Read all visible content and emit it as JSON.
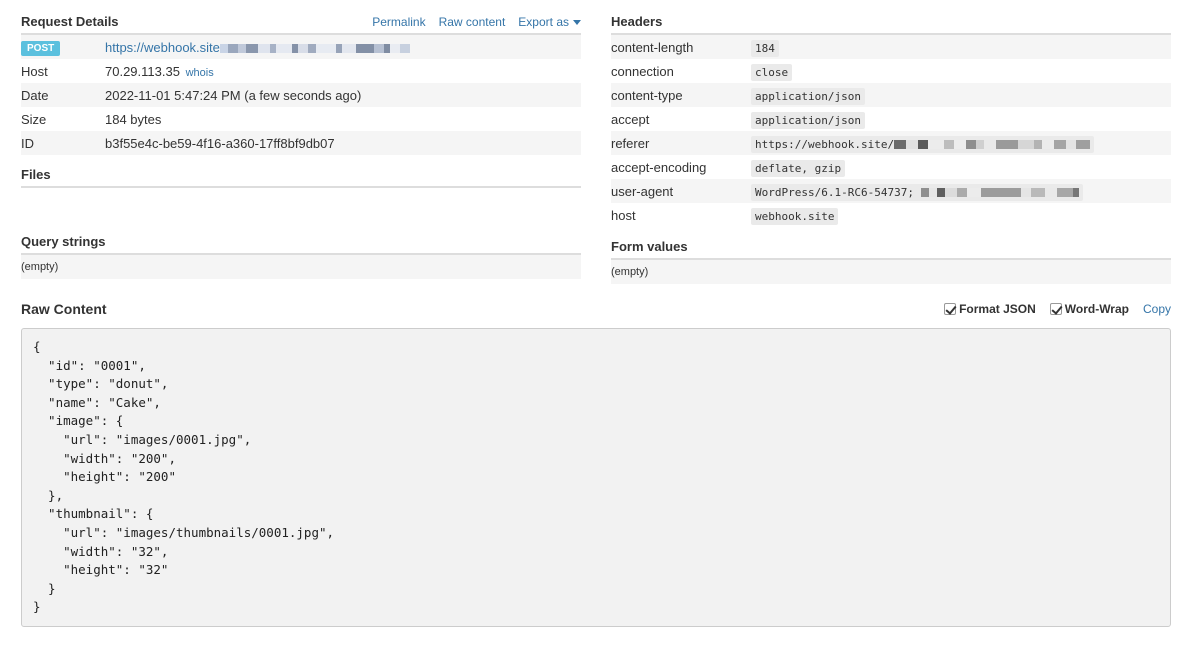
{
  "request": {
    "title": "Request Details",
    "links": {
      "permalink": "Permalink",
      "raw": "Raw content",
      "export": "Export as"
    },
    "method": "POST",
    "url": "https://webhook.site",
    "host_label": "Host",
    "host": "70.29.113.35",
    "whois": "whois",
    "date_label": "Date",
    "date": "2022-11-01 5:47:24 PM (a few seconds ago)",
    "size_label": "Size",
    "size": "184 bytes",
    "id_label": "ID",
    "id": "b3f55e4c-be59-4f16-a360-17ff8bf9db07"
  },
  "files": {
    "title": "Files"
  },
  "query": {
    "title": "Query strings",
    "empty": "(empty)"
  },
  "headers": {
    "title": "Headers",
    "rows": [
      {
        "key": "content-length",
        "value": "184"
      },
      {
        "key": "connection",
        "value": "close"
      },
      {
        "key": "content-type",
        "value": "application/json"
      },
      {
        "key": "accept",
        "value": "application/json"
      },
      {
        "key": "referer",
        "value": "https://webhook.site/"
      },
      {
        "key": "accept-encoding",
        "value": "deflate, gzip"
      },
      {
        "key": "user-agent",
        "value": "WordPress/6.1-RC6-54737;"
      },
      {
        "key": "host",
        "value": "webhook.site"
      }
    ]
  },
  "form": {
    "title": "Form values",
    "empty": "(empty)"
  },
  "raw": {
    "title": "Raw Content",
    "format_json": "Format JSON",
    "word_wrap": "Word-Wrap",
    "copy": "Copy",
    "content": "{\n  \"id\": \"0001\",\n  \"type\": \"donut\",\n  \"name\": \"Cake\",\n  \"image\": {\n    \"url\": \"images/0001.jpg\",\n    \"width\": \"200\",\n    \"height\": \"200\"\n  },\n  \"thumbnail\": {\n    \"url\": \"images/thumbnails/0001.jpg\",\n    \"width\": \"32\",\n    \"height\": \"32\"\n  }\n}"
  }
}
